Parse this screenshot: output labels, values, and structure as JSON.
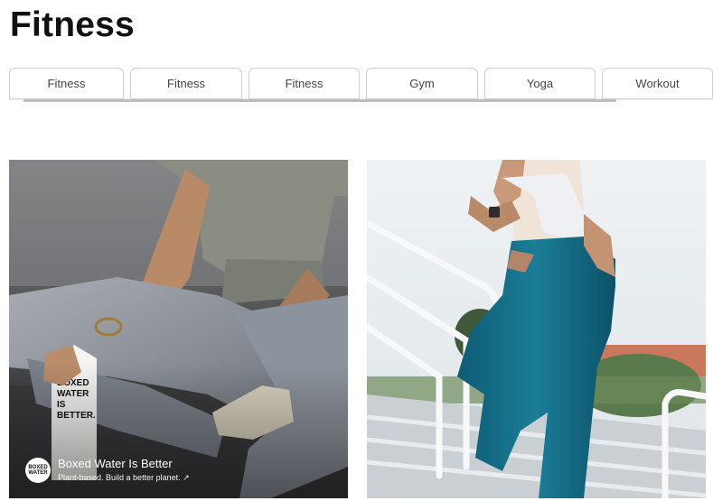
{
  "page": {
    "title": "Fitness"
  },
  "tabs": [
    {
      "label": "Fitness"
    },
    {
      "label": "Fitness"
    },
    {
      "label": "Fitness"
    },
    {
      "label": "Gym"
    },
    {
      "label": "Yoga"
    },
    {
      "label": "Workout"
    }
  ],
  "cards": [
    {
      "image": "person sitting cross-legged in grey leggings holding a Boxed Water carton",
      "carton_text": "BOXED WATER IS BETTER.",
      "sponsor": {
        "logo_text": "BOXED WATER",
        "name": "Boxed Water Is Better",
        "tagline": "Plant-based. Build a better planet. ↗"
      }
    },
    {
      "image": "woman in teal leggings running up outdoor stadium stairs"
    }
  ]
}
